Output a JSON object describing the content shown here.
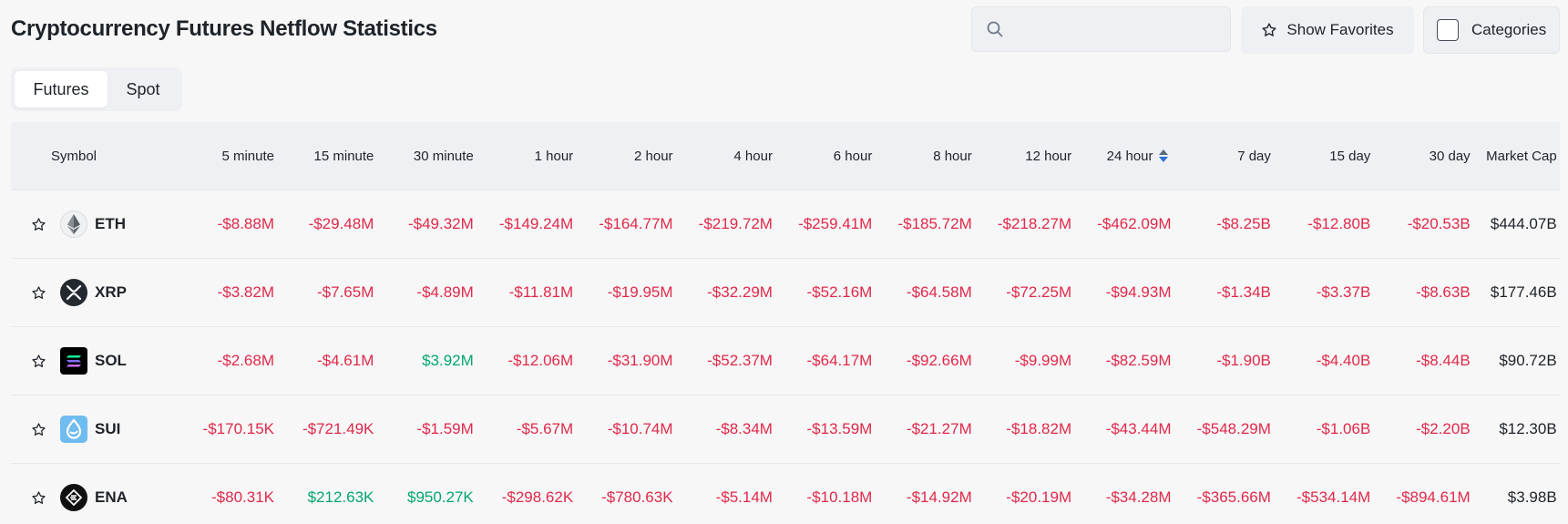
{
  "page": {
    "title": "Cryptocurrency Futures Netflow Statistics"
  },
  "toolbar": {
    "search_value": "",
    "search_placeholder": "",
    "favorites_label": "Show Favorites",
    "categories_label": "Categories"
  },
  "tabs": [
    {
      "label": "Futures",
      "active": true
    },
    {
      "label": "Spot",
      "active": false
    }
  ],
  "table": {
    "columns": [
      "Symbol",
      "5 minute",
      "15 minute",
      "30 minute",
      "1 hour",
      "2 hour",
      "4 hour",
      "6 hour",
      "8 hour",
      "12 hour",
      "24 hour",
      "7 day",
      "15 day",
      "30 day",
      "Market Cap"
    ],
    "sorted_column": "24 hour",
    "colors": {
      "negative": "#e0294a",
      "positive": "#03a66d",
      "sort_up": "#5b6b7a",
      "sort_down": "#2f6fd6"
    },
    "rows": [
      {
        "symbol": "ETH",
        "icon": "ethereum-icon",
        "values": [
          "-$8.88M",
          "-$29.48M",
          "-$49.32M",
          "-$149.24M",
          "-$164.77M",
          "-$219.72M",
          "-$259.41M",
          "-$185.72M",
          "-$218.27M",
          "-$462.09M",
          "-$8.25B",
          "-$12.80B",
          "-$20.53B"
        ],
        "market_cap": "$444.07B"
      },
      {
        "symbol": "XRP",
        "icon": "xrp-icon",
        "values": [
          "-$3.82M",
          "-$7.65M",
          "-$4.89M",
          "-$11.81M",
          "-$19.95M",
          "-$32.29M",
          "-$52.16M",
          "-$64.58M",
          "-$72.25M",
          "-$94.93M",
          "-$1.34B",
          "-$3.37B",
          "-$8.63B"
        ],
        "market_cap": "$177.46B"
      },
      {
        "symbol": "SOL",
        "icon": "solana-icon",
        "values": [
          "-$2.68M",
          "-$4.61M",
          "$3.92M",
          "-$12.06M",
          "-$31.90M",
          "-$52.37M",
          "-$64.17M",
          "-$92.66M",
          "-$9.99M",
          "-$82.59M",
          "-$1.90B",
          "-$4.40B",
          "-$8.44B"
        ],
        "market_cap": "$90.72B"
      },
      {
        "symbol": "SUI",
        "icon": "sui-icon",
        "values": [
          "-$170.15K",
          "-$721.49K",
          "-$1.59M",
          "-$5.67M",
          "-$10.74M",
          "-$8.34M",
          "-$13.59M",
          "-$21.27M",
          "-$18.82M",
          "-$43.44M",
          "-$548.29M",
          "-$1.06B",
          "-$2.20B"
        ],
        "market_cap": "$12.30B"
      },
      {
        "symbol": "ENA",
        "icon": "ethena-icon",
        "values": [
          "-$80.31K",
          "$212.63K",
          "$950.27K",
          "-$298.62K",
          "-$780.63K",
          "-$5.14M",
          "-$10.18M",
          "-$14.92M",
          "-$20.19M",
          "-$34.28M",
          "-$365.66M",
          "-$534.14M",
          "-$894.61M"
        ],
        "market_cap": "$3.98B"
      }
    ]
  }
}
